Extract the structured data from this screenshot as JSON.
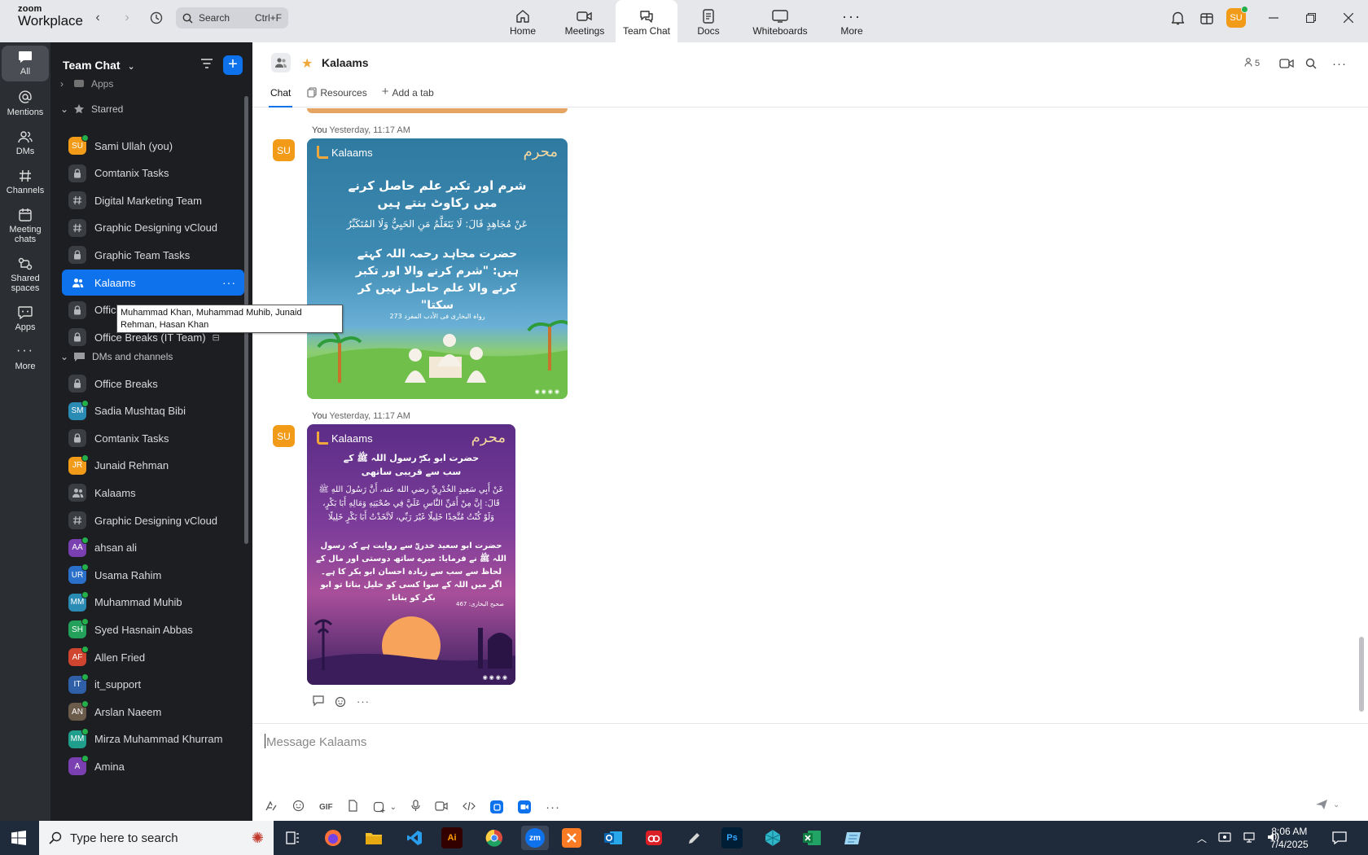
{
  "app": {
    "logo_line1": "zoom",
    "logo_line2": "Workplace"
  },
  "search": {
    "label": "Search",
    "shortcut": "Ctrl+F"
  },
  "main_tabs": [
    {
      "label": "Home",
      "icon": "home-icon"
    },
    {
      "label": "Meetings",
      "icon": "video-icon"
    },
    {
      "label": "Team Chat",
      "icon": "chat-icon",
      "active": true
    },
    {
      "label": "Docs",
      "icon": "doc-icon"
    },
    {
      "label": "Whiteboards",
      "icon": "whiteboard-icon"
    },
    {
      "label": "More",
      "icon": "more-icon"
    }
  ],
  "user": {
    "initials": "SU",
    "color": "#f29b18",
    "status_color": "#23b04b"
  },
  "rail": [
    {
      "label": "All",
      "icon": "chat-bubble-icon",
      "active": true
    },
    {
      "label": "Mentions",
      "icon": "at-icon"
    },
    {
      "label": "DMs",
      "icon": "people-icon"
    },
    {
      "label": "Channels",
      "icon": "hash-icon"
    },
    {
      "label": "Meeting chats",
      "icon": "calendar-icon"
    },
    {
      "label": "Shared spaces",
      "icon": "shared-icon"
    },
    {
      "label": "Apps",
      "icon": "apps-icon"
    },
    {
      "label": "More",
      "icon": "more-icon"
    }
  ],
  "sidebar": {
    "title": "Team Chat",
    "partial_section": "Apps",
    "starred_label": "Starred",
    "starred": [
      {
        "name": "Sami Ullah (you)",
        "type": "avatar",
        "initials": "SU",
        "color": "#f29b18"
      },
      {
        "name": "Comtanix Tasks",
        "type": "lock"
      },
      {
        "name": "Digital Marketing Team",
        "type": "hash"
      },
      {
        "name": "Graphic Designing vCloud",
        "type": "hash"
      },
      {
        "name": "Graphic Team Tasks",
        "type": "lock"
      },
      {
        "name": "Kalaams",
        "type": "group",
        "active": true
      },
      {
        "name": "Office",
        "type": "lock"
      },
      {
        "name": "Office Breaks (IT Team)",
        "type": "lock",
        "archived": true
      }
    ],
    "dms_label": "DMs and channels",
    "dms": [
      {
        "name": "Office Breaks",
        "type": "lock"
      },
      {
        "name": "Sadia Mushtaq Bibi",
        "type": "avatar",
        "initials": "SM",
        "color": "#2a8bb5"
      },
      {
        "name": "Comtanix Tasks",
        "type": "lock"
      },
      {
        "name": "Junaid Rehman",
        "type": "avatar",
        "initials": "JR",
        "color": "#f29b18"
      },
      {
        "name": "Kalaams",
        "type": "group"
      },
      {
        "name": "Graphic Designing vCloud",
        "type": "hash"
      },
      {
        "name": "ahsan ali",
        "type": "avatar",
        "initials": "AA",
        "color": "#7a3fb0"
      },
      {
        "name": "Usama Rahim",
        "type": "avatar",
        "initials": "UR",
        "color": "#2a6fc9"
      },
      {
        "name": "Muhammad Muhib",
        "type": "avatar",
        "initials": "MM",
        "color": "#2a8bb5"
      },
      {
        "name": "Syed Hasnain Abbas",
        "type": "avatar",
        "initials": "SH",
        "color": "#23a05a"
      },
      {
        "name": "Allen Fried",
        "type": "avatar",
        "initials": "AF",
        "color": "#d0452f"
      },
      {
        "name": "it_support",
        "type": "avatar",
        "initials": "IT",
        "color": "#2f5fa7"
      },
      {
        "name": "Arslan Naeem",
        "type": "avatar",
        "initials": "AN",
        "color": "#6b5b4b"
      },
      {
        "name": "Mirza Muhammad Khurram",
        "type": "avatar",
        "initials": "MM",
        "color": "#1f9e8c"
      },
      {
        "name": "Amina",
        "type": "avatar",
        "initials": "A",
        "color": "#7a3fb0"
      }
    ],
    "tooltip": "Muhammad Khan, Muhammad Muhib, Junaid Rehman, Hasan Khan"
  },
  "chat": {
    "title": "Kalaams",
    "member_count": "5",
    "tabs": [
      {
        "label": "Chat",
        "active": true
      },
      {
        "label": "Resources"
      },
      {
        "label": "Add a tab"
      }
    ],
    "messages": [
      {
        "sender": "You",
        "time": "Yesterday, 11:17 AM",
        "avatar": "SU",
        "post": {
          "brand": "Kalaams",
          "badge": "محرم",
          "heading": "شرم اور تکبر علم حاصل کرنے میں رکاوٹ بنتے ہیں",
          "arabic": "عَنْ مُجَاهِدٍ قَالَ: لَا يَتَعَلَّمُ مَنِ الحَيِيُّ وَلَا المُتَكَبِّرُ",
          "translation": "حضرت مجاہد رحمہ اللہ کہتے ہیں: \"شرم کرنے والا اور تکبر کرنے والا علم حاصل نہیں کر سکتا\"",
          "reference": "رواہ البخاری فی الأدب المفرد 273"
        }
      },
      {
        "sender": "You",
        "time": "Yesterday, 11:17 AM",
        "avatar": "SU",
        "post": {
          "brand": "Kalaams",
          "badge": "محرم",
          "heading": "حضرت ابو بکرؓ رسول اللہ ﷺ کے سب سے قریبی ساتھی",
          "arabic": "عَنْ أَبِي سَعِيدٍ الخُدْرِيِّ رضي الله عنه، أَنَّ رَسُولَ اللهِ ﷺ قَالَ: إِنَّ مِنْ أَمَنِّ النَّاسِ عَلَيَّ فِي صُحْبَتِهِ وَمَالِهِ أَبَا بَكْرٍ، وَلَوْ كُنْتُ مُتَّخِذًا خَلِيلًا غَيْرَ رَبِّي، لَاتَّخَذْتُ أَبَا بَكْرٍ خَلِيلًا",
          "translation": "حضرت ابو سعید خدریؓ سے روایت ہے کہ رسول اللہ ﷺ نے فرمایا: میرے ساتھ دوستی اور مال کے لحاظ سے سب سے زیادہ احسان ابو بکر کا ہے۔ اگر میں اللہ کے سوا کسی کو خلیل بناتا تو ابو بکر کو بناتا۔",
          "reference": "صحیح البخاری: 467"
        }
      }
    ],
    "composer_placeholder": "Message Kalaams",
    "toolbar_gif": "GIF"
  },
  "taskbar": {
    "search_placeholder": "Type here to search",
    "apps": [
      "task-view-icon",
      "firefox-icon",
      "file-explorer-icon",
      "vscode-icon",
      "illustrator-icon",
      "chrome-icon",
      "zoom-icon",
      "xampp-icon",
      "outlook-icon",
      "creative-cloud-icon",
      "pen-tool-icon",
      "photoshop-icon",
      "app-icon",
      "excel-icon",
      "notepad-icon"
    ],
    "zoom_label": "zm",
    "ai_label": "Ai",
    "ps_label": "Ps",
    "time": "8:06 AM",
    "date": "7/4/2025"
  }
}
